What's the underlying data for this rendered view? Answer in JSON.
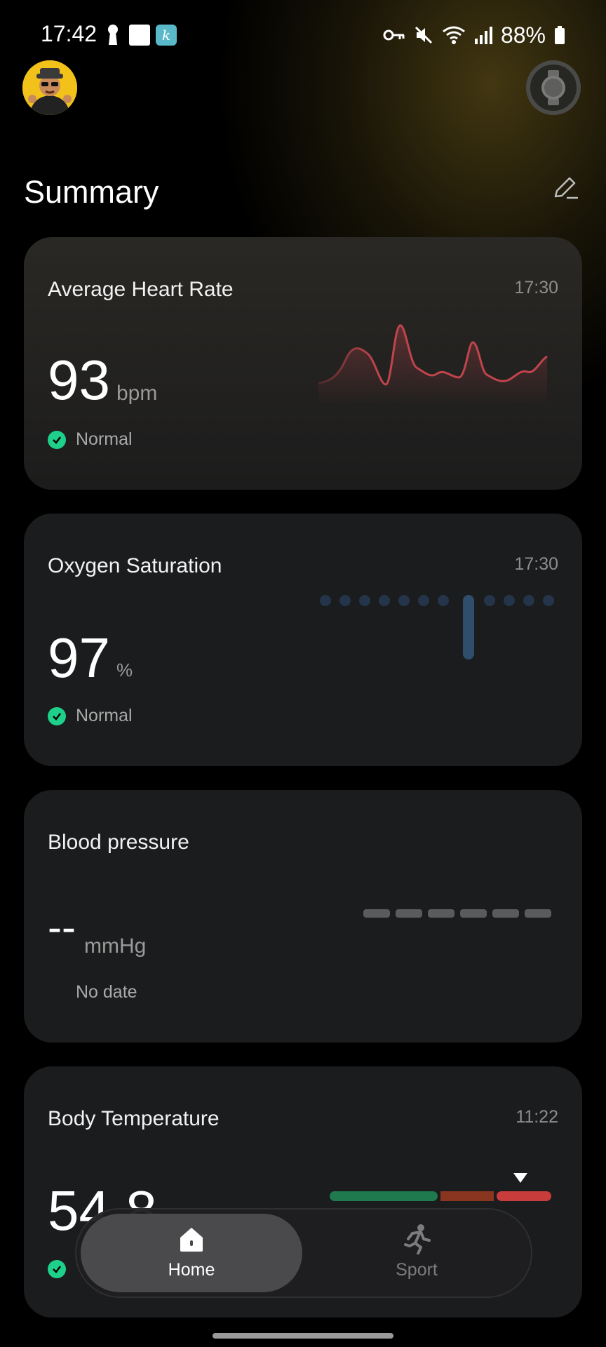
{
  "status_bar": {
    "time": "17:42",
    "battery": "88%",
    "app_icon_letter": "k"
  },
  "header": {
    "title": "Summary"
  },
  "cards": {
    "heart": {
      "title": "Average Heart Rate",
      "time": "17:30",
      "value": "93",
      "unit": "bpm",
      "status": "Normal"
    },
    "oxygen": {
      "title": "Oxygen Saturation",
      "time": "17:30",
      "value": "97",
      "unit": "%",
      "status": "Normal"
    },
    "bp": {
      "title": "Blood pressure",
      "value": "--",
      "unit": "mmHg",
      "status": "No date"
    },
    "temp": {
      "title": "Body Temperature",
      "time": "11:22",
      "value": "54.8"
    }
  },
  "nav": {
    "home_label": "Home",
    "sport_label": "Sport",
    "active": "Home"
  },
  "colors": {
    "accent_green": "#1fd08a",
    "heart_line": "#c0444c",
    "temp_range": [
      "#1f7a4e",
      "#8a3520",
      "#c83c3c"
    ]
  }
}
